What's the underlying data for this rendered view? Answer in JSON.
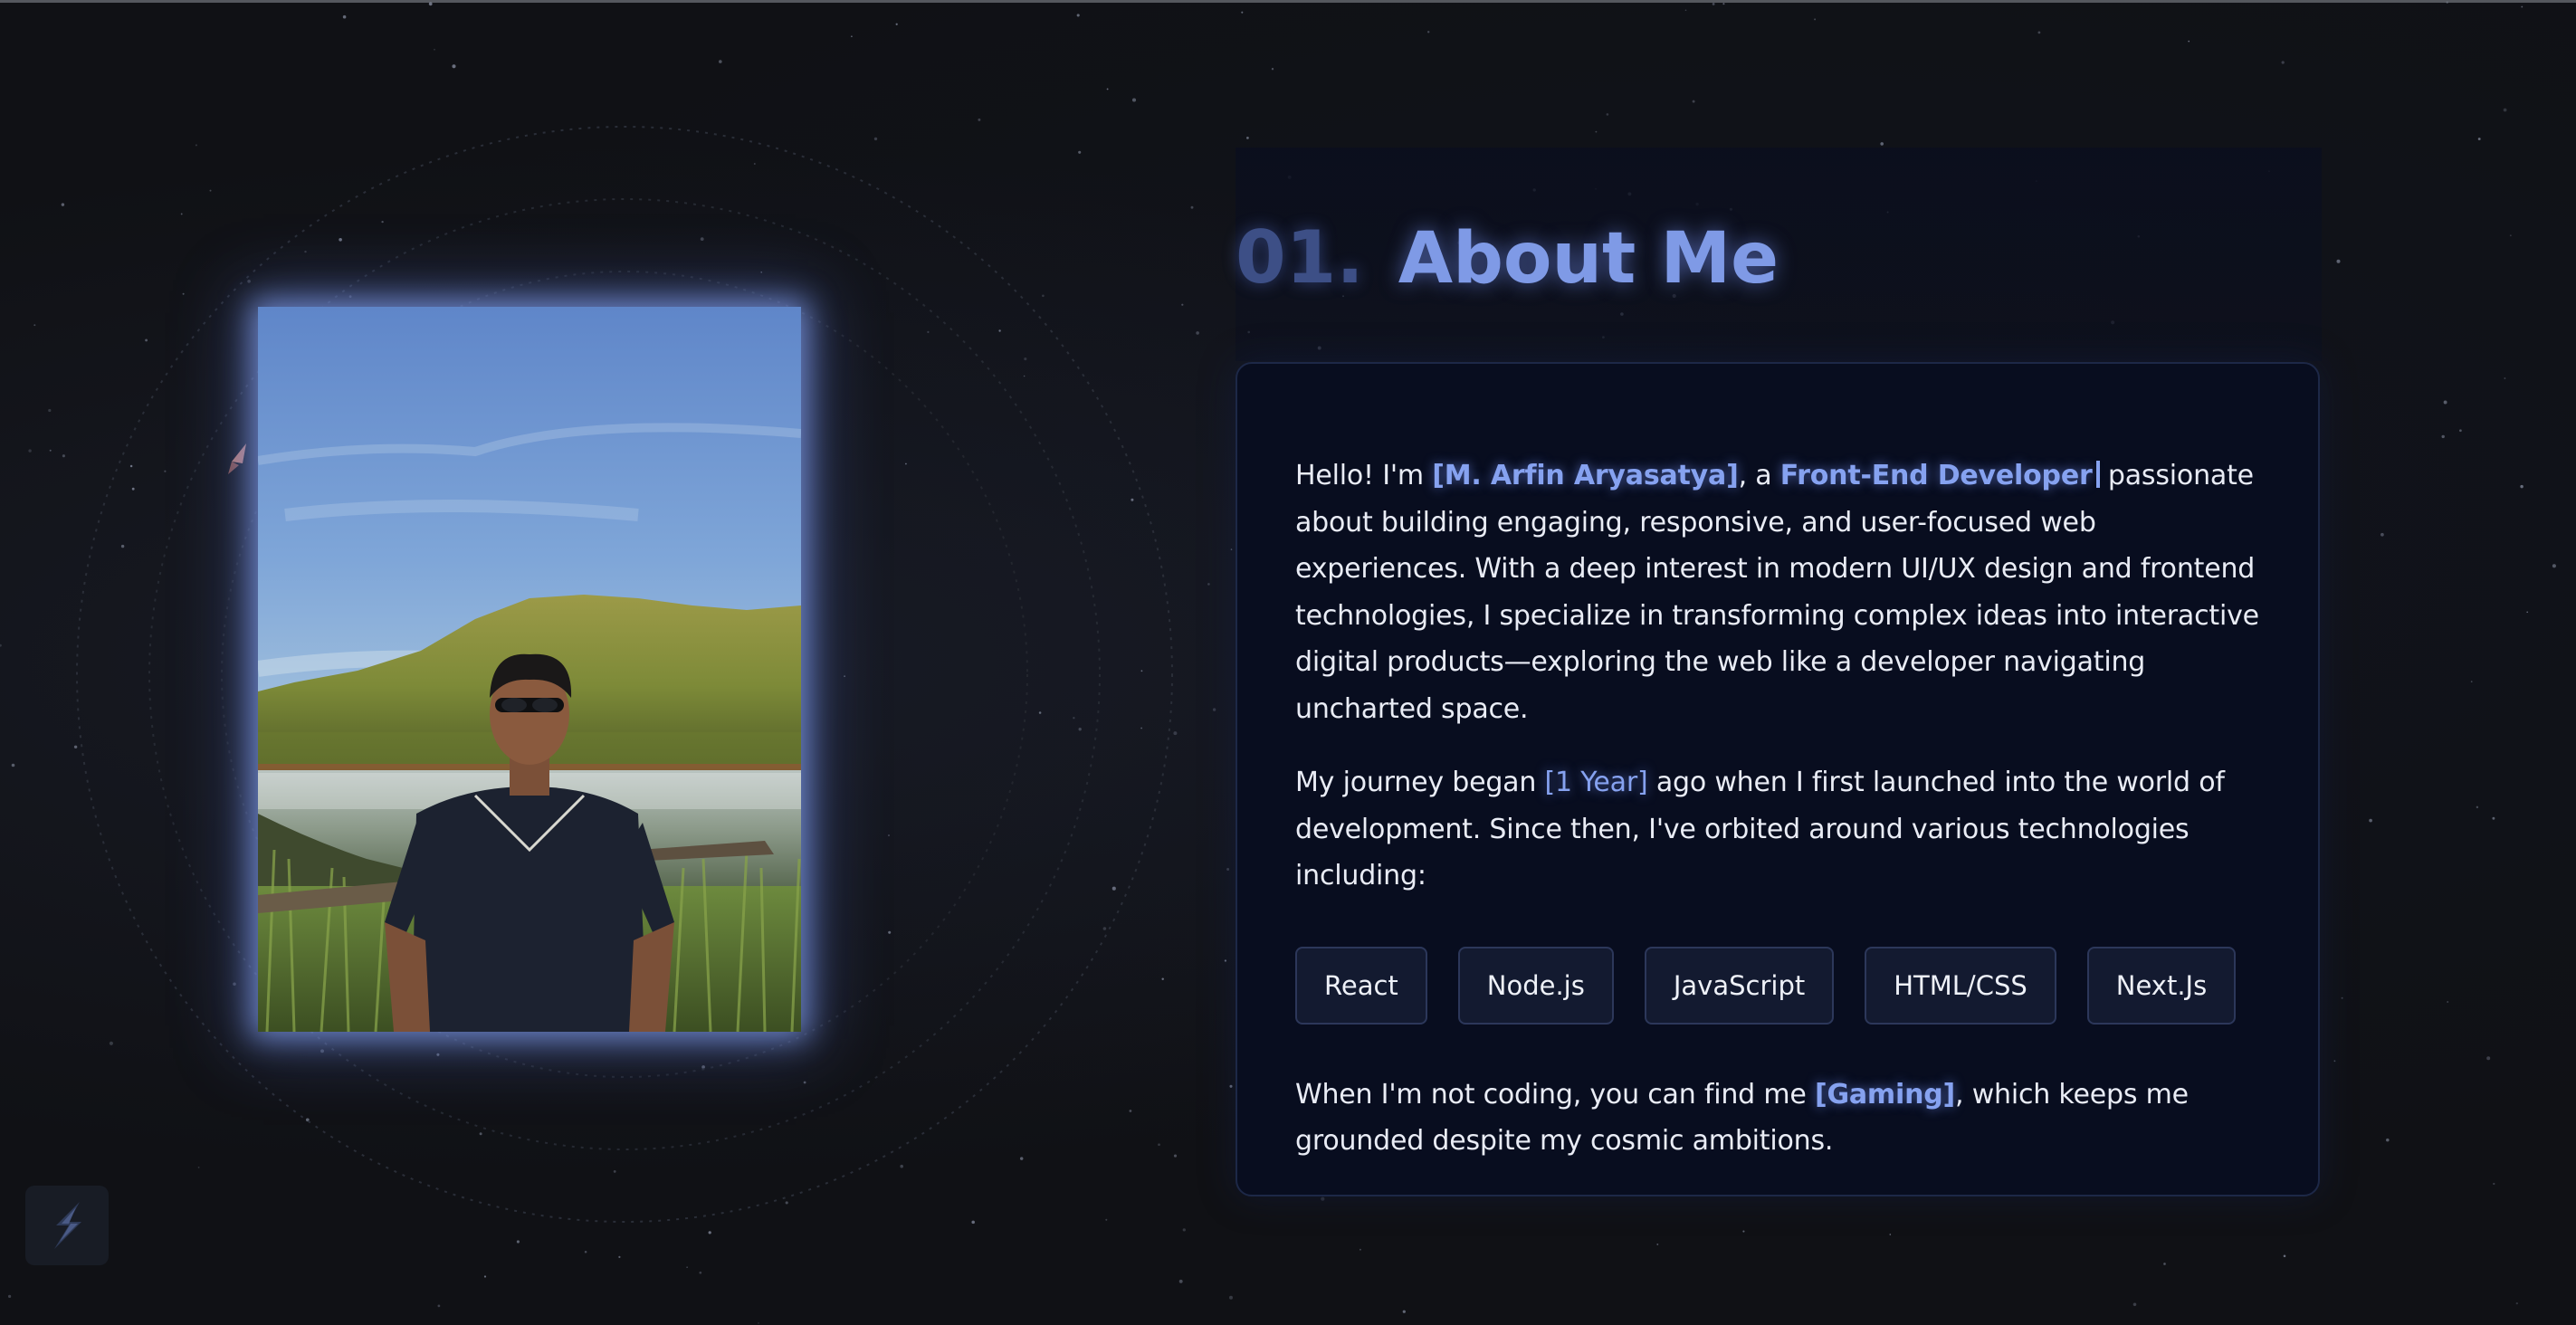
{
  "section": {
    "number": "01.",
    "title": "About Me"
  },
  "about": {
    "p1": {
      "intro": "Hello! I'm ",
      "name": "[M. Arfin Aryasatya]",
      "mid": ", a ",
      "role": "Front-End Developer",
      "rest": " passionate about building engaging, responsive, and user-focused web experiences. With a deep interest in modern UI/UX design and frontend technologies, I specialize in transforming complex ideas into interactive digital products—exploring the web like a developer navigating uncharted space."
    },
    "p2": {
      "intro": "My journey began ",
      "duration": "[1 Year]",
      "rest": " ago when I first launched into the world of development. Since then, I've orbited around various technologies including:"
    },
    "technologies": [
      "React",
      "Node.js",
      "JavaScript",
      "HTML/CSS",
      "Next.Js"
    ],
    "p3": {
      "intro": "When I'm not coding, you can find me ",
      "hobby": "[Gaming]",
      "rest": ", which keeps me grounded despite my cosmic ambitions."
    }
  },
  "icons": {
    "logo": "lightning-logo-icon",
    "photo": "profile-photo"
  },
  "colors": {
    "accent": "#86a2f0",
    "background": "#101115",
    "card": "#080d1f",
    "tag_background": "#131a30"
  }
}
